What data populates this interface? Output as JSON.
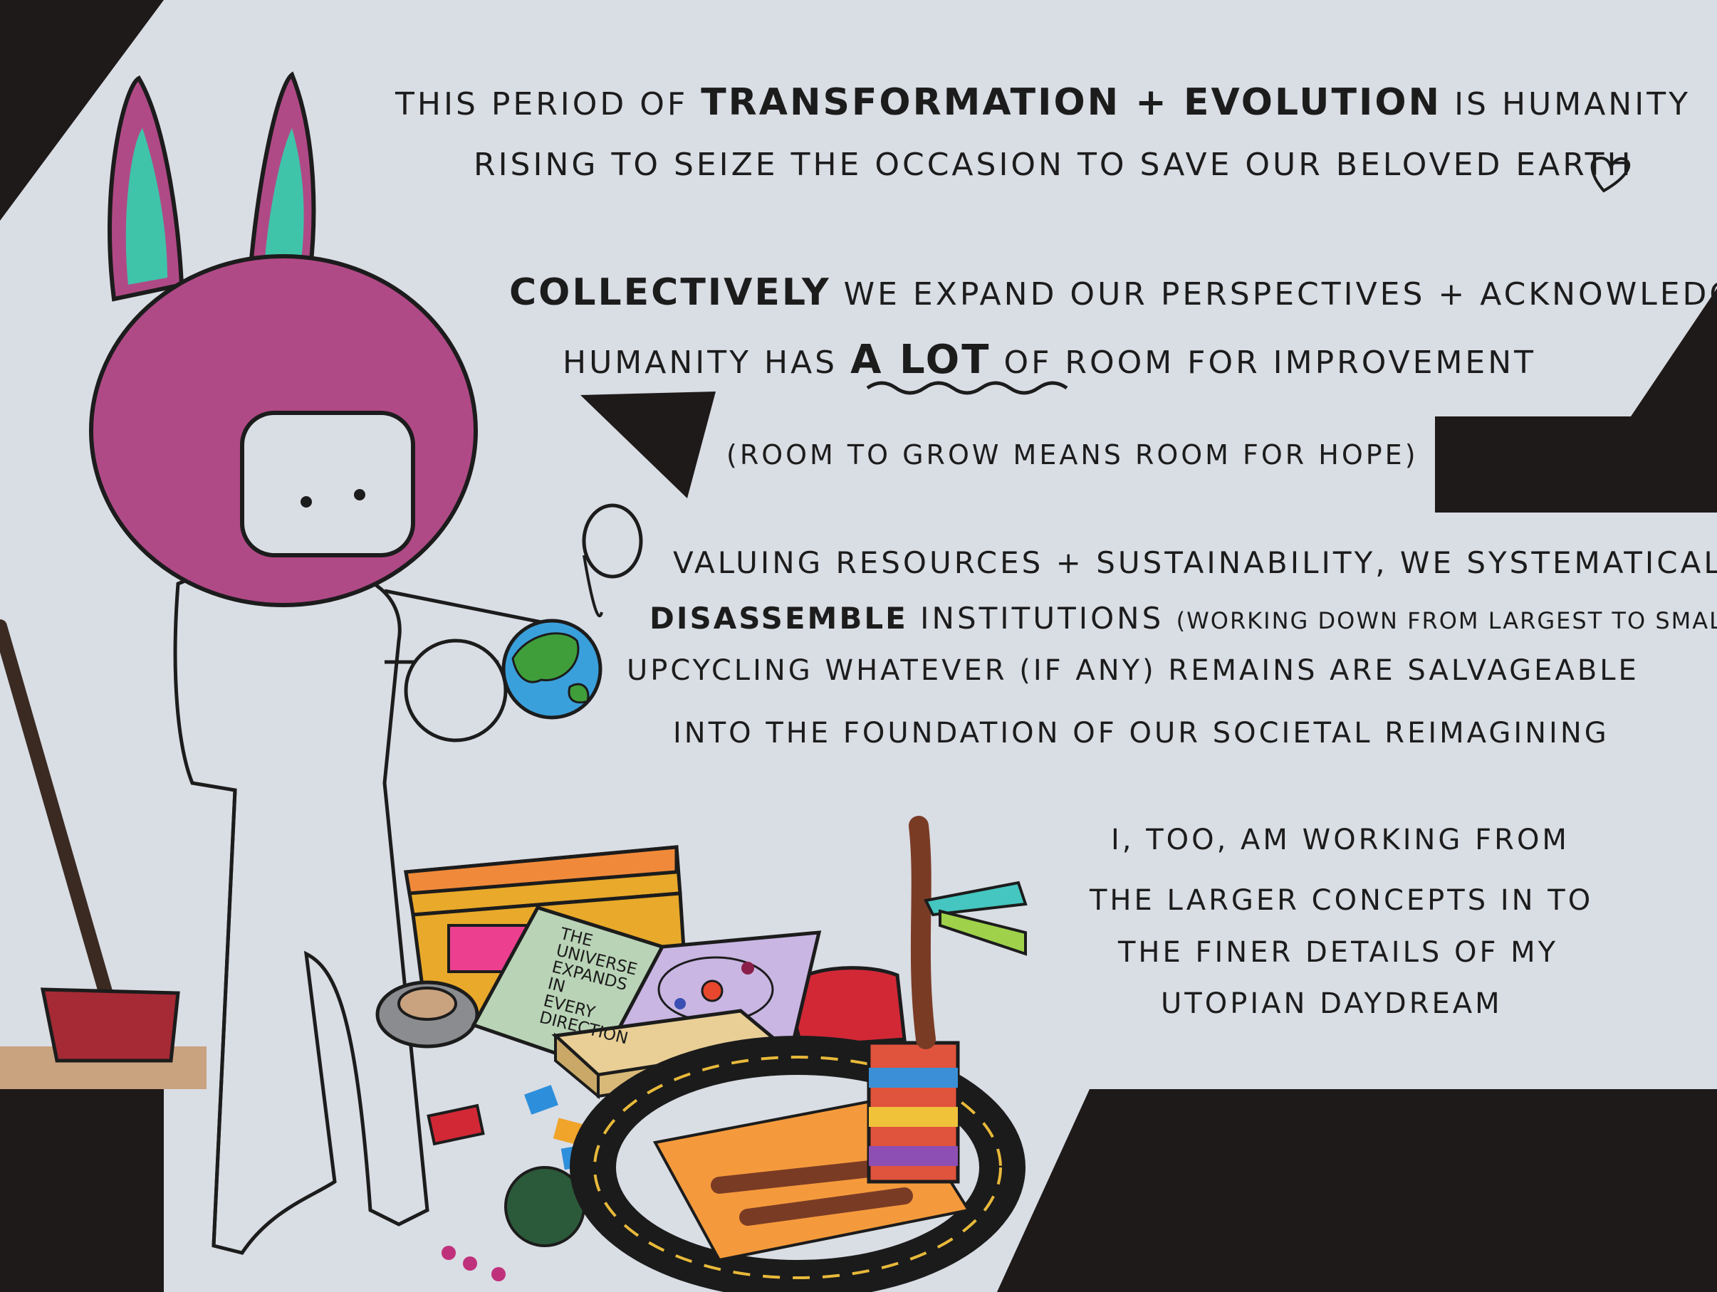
{
  "palette": {
    "paper": "#d9dde4",
    "background_dark": "#1e1a19",
    "ink": "#1c1c1c",
    "helmet": "#b04a86",
    "ear_inner": "#3fc4aa",
    "globe_water": "#3aa0dc",
    "globe_land": "#3f9e3a",
    "box_lid": "#f08a3a",
    "box_body": "#e9a92a",
    "book_cover": "#b9d3b6",
    "shovel": "#a52a35",
    "rug": "#f59a3c",
    "track": "#1b1b1b"
  },
  "icons": {
    "character": "bunny-hat-character-icon",
    "globe": "earth-globe-icon",
    "heart": "heart-icon",
    "shovel": "shovel-icon",
    "toy_box": "toy-box-icon",
    "book": "book-icon",
    "puzzle": "puzzle-box-icon",
    "tape": "tape-roll-icon",
    "telephone": "telephone-icon",
    "block_tower": "block-tower-icon",
    "windmill": "stick-windmill-icon",
    "race_track": "race-track-rug-icon",
    "yarn": "yarn-ball-icon"
  },
  "text": {
    "p1_l1_a": "This period of",
    "p1_l1_b": "Transformation + Evolution",
    "p1_l1_c": "is Humanity",
    "p1_l2": "Rising to seize the occasion to save our beloved Earth",
    "p2_l1_a": "Collectively",
    "p2_l1_b": "we expand our perspectives + acknowledge",
    "p2_l2_a": "Humanity has",
    "p2_l2_b": "A lot",
    "p2_l2_c": "of room for improvement",
    "p3": "(Room to grow means room for hope)",
    "p4_l1": "Valuing resources + sustainability, we systematically",
    "p4_l2_a": "Disassemble",
    "p4_l2_b": "institutions",
    "p4_l2_c": "(working down from largest to smallest)",
    "p4_l3": "upcycling whatever (if any) remains are salvageable",
    "p4_l4": "into the foundation of our societal reimagining",
    "p5_l1": "I, too, am working from",
    "p5_l2": "the larger concepts in to",
    "p5_l3": "the finer details of my",
    "p5_l4": "utopian daydream",
    "book_l1": "The",
    "book_l2": "Universe",
    "book_l3": "Expands",
    "book_l4": "in",
    "book_l5": "Every",
    "book_l6": "Direction"
  }
}
